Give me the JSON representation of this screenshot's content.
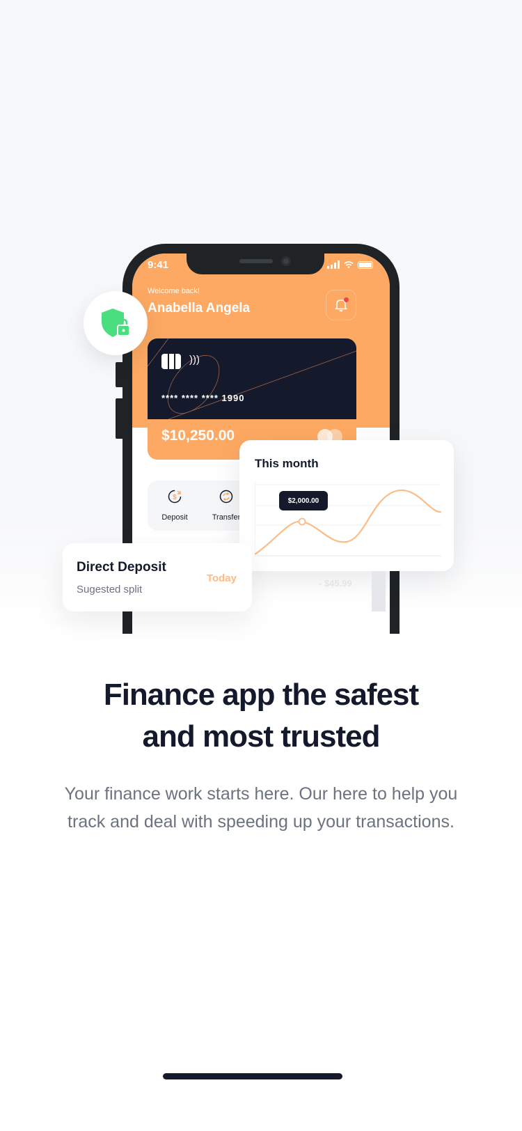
{
  "phone": {
    "status_time": "9:41",
    "welcome": "Welcome back!",
    "user_name": "Anabella Angela",
    "card": {
      "number": "****  ****  ****  1990",
      "balance": "$10,250.00"
    },
    "actions": [
      {
        "label": "Deposit"
      },
      {
        "label": "Transfer"
      }
    ]
  },
  "month_card": {
    "title": "This month",
    "tooltip": "$2,000.00"
  },
  "deposit_card": {
    "title": "Direct Deposit",
    "subtitle": "Sugested split",
    "when": "Today"
  },
  "ghost_amount": "- $45.99",
  "headline": "Finance app the safest and most trusted",
  "description": "Your finance work starts here. Our here to help you track and deal with speeding up your transactions.",
  "colors": {
    "accent": "#fda963",
    "dark": "#141a2b",
    "shield": "#4ade80",
    "muted_text": "#6b7280"
  },
  "icons": [
    "bell-icon",
    "shield-lock-icon",
    "deposit-icon",
    "transfer-icon",
    "mastercard-icon",
    "chip-icon",
    "nfc-icon"
  ]
}
